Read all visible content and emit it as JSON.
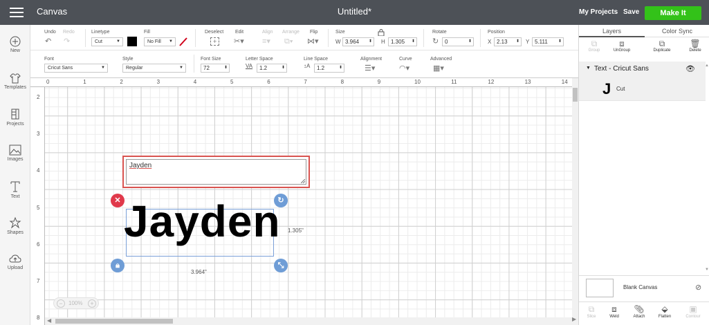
{
  "topbar": {
    "app_name": "Canvas",
    "doc_title": "Untitled*",
    "my_projects": "My Projects",
    "save": "Save",
    "make_it": "Make It"
  },
  "leftnav": {
    "new": "New",
    "templates": "Templates",
    "projects": "Projects",
    "images": "Images",
    "text": "Text",
    "shapes": "Shapes",
    "upload": "Upload"
  },
  "edit_toolbar": {
    "undo": "Undo",
    "redo": "Redo",
    "linetype_label": "Linetype",
    "linetype_value": "Cut",
    "fill_label": "Fill",
    "fill_value": "No Fill",
    "deselect": "Deselect",
    "edit": "Edit",
    "align": "Align",
    "arrange": "Arrange",
    "flip": "Flip",
    "size_label": "Size",
    "width_label": "W",
    "width_value": "3.964",
    "height_label": "H",
    "height_value": "1.305",
    "rotate_label": "Rotate",
    "rotate_value": "0",
    "position_label": "Position",
    "x_label": "X",
    "x_value": "2.13",
    "y_label": "Y",
    "y_value": "5.111",
    "colors": {
      "linetype_swatch": "#000000",
      "fill_slash": "#d0021b"
    }
  },
  "text_toolbar": {
    "font_label": "Font",
    "font_value": "Cricut Sans",
    "style_label": "Style",
    "style_value": "Regular",
    "font_size_label": "Font Size",
    "font_size_value": "72",
    "letter_space_label": "Letter Space",
    "letter_space_value": "1.2",
    "line_space_label": "Line Space",
    "line_space_value": "1.2",
    "alignment_label": "Alignment",
    "curve_label": "Curve",
    "advanced_label": "Advanced"
  },
  "canvas": {
    "ruler_x": [
      "0",
      "1",
      "2",
      "3",
      "4",
      "5",
      "6",
      "7",
      "8",
      "9",
      "10",
      "11",
      "12",
      "13",
      "14"
    ],
    "ruler_y": [
      "2",
      "3",
      "4",
      "5",
      "6",
      "7",
      "8"
    ],
    "textbox_value": "Jayden",
    "design_text": "Jayden",
    "dim_height": "1.305\"",
    "dim_width": "3.964\"",
    "zoom": "100%",
    "colors": {
      "selection": "#7aa0d8",
      "delete_handle": "#e0394b",
      "other_handles": "#6f9dd6",
      "textbox_border": "#d9534f"
    }
  },
  "layers_panel": {
    "tab_layers": "Layers",
    "tab_color_sync": "Color Sync",
    "group": "Group",
    "ungroup": "UnGroup",
    "duplicate": "Duplicate",
    "delete": "Delete",
    "layer_group_name": "Text - Cricut Sans",
    "layer_item_label": "Cut",
    "blank_canvas": "Blank Canvas",
    "slice": "Slice",
    "weld": "Weld",
    "attach": "Attach",
    "flatten": "Flatten",
    "contour": "Contour"
  }
}
